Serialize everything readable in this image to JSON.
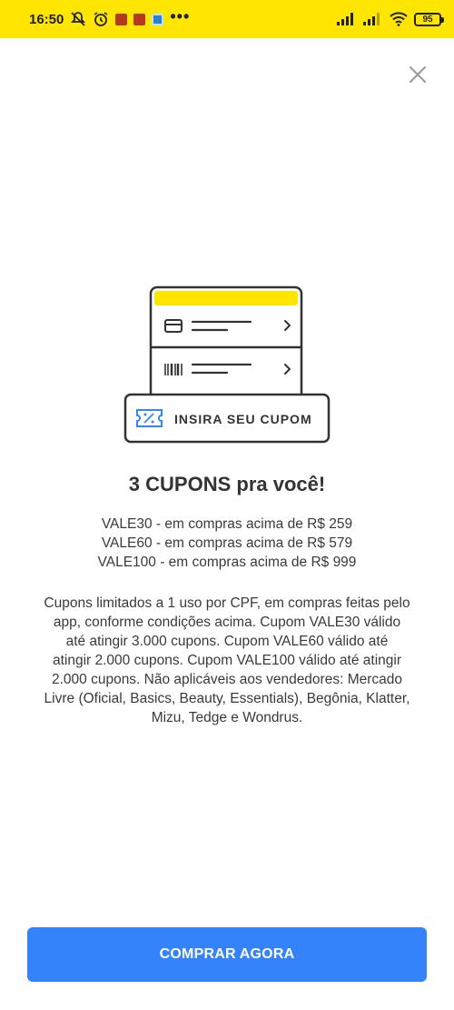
{
  "status_bar": {
    "time": "16:50",
    "battery": "95",
    "overflow": "•••",
    "background": "#ffe600"
  },
  "header": {
    "close_icon": "close-icon"
  },
  "illustration": {
    "coupon_label": "INSIRA SEU CUPOM",
    "accent": "#ffe600"
  },
  "content": {
    "title": "3 CUPONS pra você!",
    "coupons": [
      "VALE30 - em compras acima de R$ 259",
      "VALE60 - em compras acima de R$ 579",
      "VALE100 - em compras acima de R$ 999"
    ],
    "terms": [
      "Cupons limitados a 1 uso por CPF, em compras feitas pelo",
      "app, conforme condições acima. Cupom VALE30 válido",
      "até atingir 3.000 cupons. Cupom VALE60 válido até",
      "atingir 2.000 cupons. Cupom VALE100 válido até atingir",
      "2.000 cupons. Não aplicáveis aos vendedores: Mercado",
      "Livre (Oficial, Basics, Beauty, Essentials), Begônia, Klatter,",
      "Mizu, Tedge e Wondrus."
    ]
  },
  "footer": {
    "buy_label": "COMPRAR AGORA",
    "button_color": "#3483fa"
  }
}
